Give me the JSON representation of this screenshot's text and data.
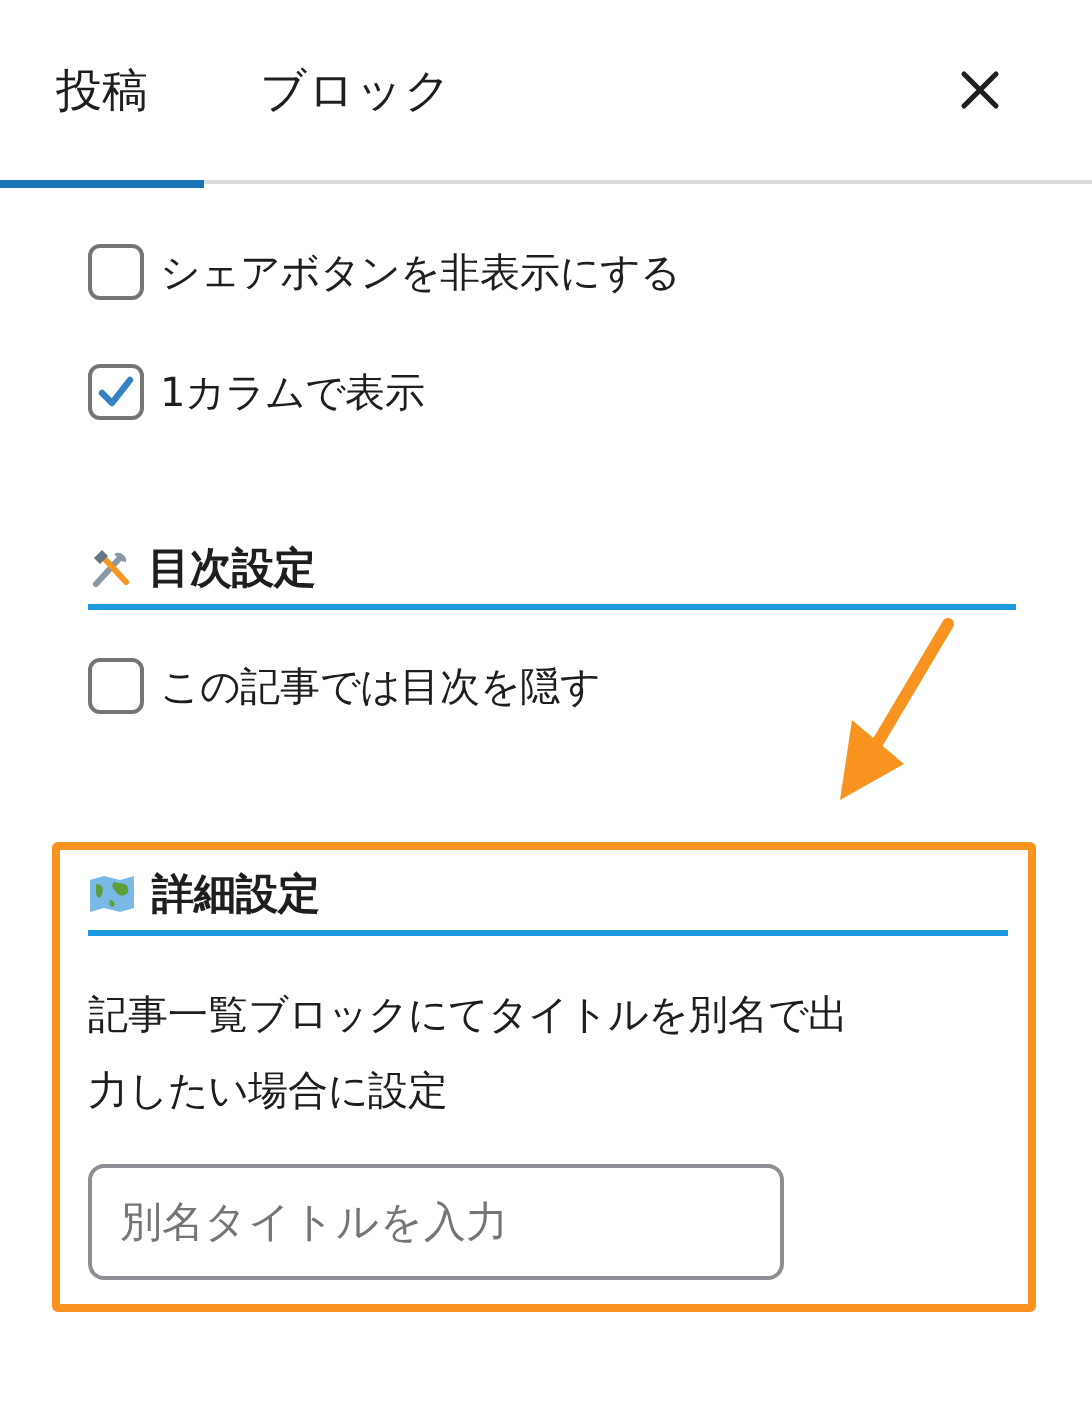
{
  "tabs": [
    {
      "label": "投稿",
      "selected": true
    },
    {
      "label": "ブロック",
      "selected": false
    }
  ],
  "options": [
    {
      "label": "シェアボタンを非表示にする",
      "checked": false
    },
    {
      "label": "1カラムで表示",
      "checked": true
    }
  ],
  "sections": [
    {
      "title": "目次設定",
      "highlighted": false,
      "options": [
        {
          "label": "この記事では目次を隠す",
          "checked": false
        }
      ]
    },
    {
      "title": "詳細設定",
      "highlighted": true,
      "description": "記事一覧ブロックにてタイトルを別名で出力したい場合に設定",
      "field": {
        "placeholder": "別名タイトルを入力"
      }
    }
  ]
}
